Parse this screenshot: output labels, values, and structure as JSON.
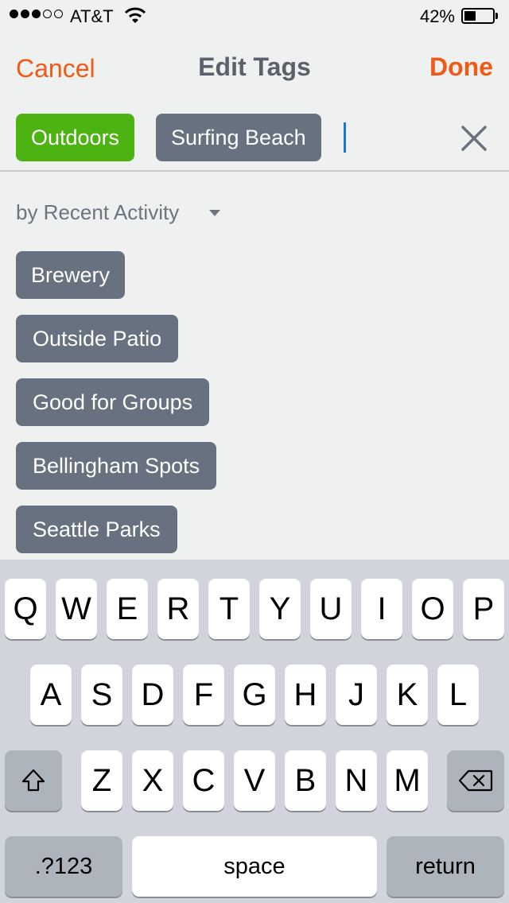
{
  "status_bar": {
    "carrier": "AT&T",
    "signal_bars_filled": 3,
    "signal_bars_total": 5,
    "battery_percent": "42%",
    "battery_level": 0.42
  },
  "nav": {
    "cancel_label": "Cancel",
    "title": "Edit Tags",
    "done_label": "Done"
  },
  "selected_tags": [
    {
      "label": "Outdoors",
      "color": "#4cb312"
    },
    {
      "label": "Surfing Beach",
      "color": "#687180"
    }
  ],
  "tag_input": {
    "value": ""
  },
  "sort": {
    "label": "by Recent Activity"
  },
  "suggested_tags": [
    {
      "label": "Brewery"
    },
    {
      "label": "Outside Patio"
    },
    {
      "label": "Good for Groups"
    },
    {
      "label": "Bellingham Spots"
    },
    {
      "label": "Seattle Parks"
    }
  ],
  "keyboard": {
    "row1": [
      "Q",
      "W",
      "E",
      "R",
      "T",
      "Y",
      "U",
      "I",
      "O",
      "P"
    ],
    "row2": [
      "A",
      "S",
      "D",
      "F",
      "G",
      "H",
      "J",
      "K",
      "L"
    ],
    "row3": [
      "Z",
      "X",
      "C",
      "V",
      "B",
      "N",
      "M"
    ],
    "shift_icon": "shift-icon",
    "delete_icon": "backspace-icon",
    "numbers_label": ".?123",
    "space_label": "space",
    "return_label": "return"
  },
  "colors": {
    "accent": "#f05a16",
    "tag_slate": "#687180",
    "tag_green": "#4cb312",
    "cursor": "#1976d2"
  }
}
